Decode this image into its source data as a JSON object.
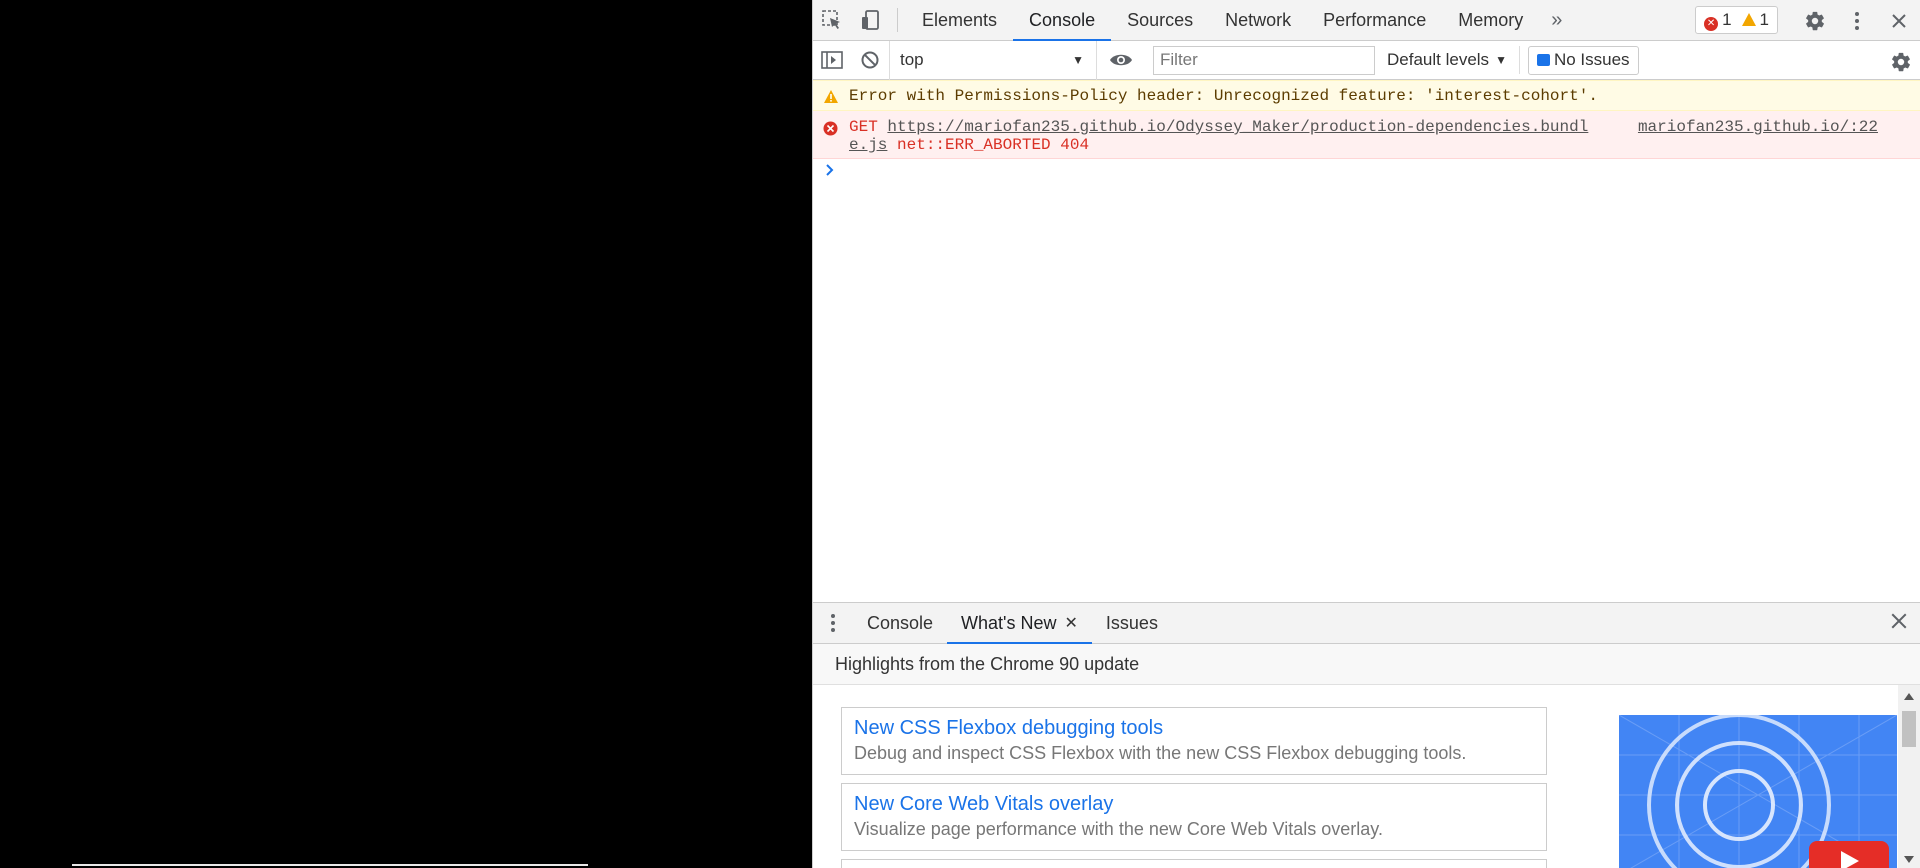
{
  "main_tabs": [
    {
      "label": "Elements",
      "active": false
    },
    {
      "label": "Console",
      "active": true
    },
    {
      "label": "Sources",
      "active": false
    },
    {
      "label": "Network",
      "active": false
    },
    {
      "label": "Performance",
      "active": false
    },
    {
      "label": "Memory",
      "active": false
    }
  ],
  "counters": {
    "errors": "1",
    "warnings": "1"
  },
  "console_toolbar": {
    "context": "top",
    "filter_placeholder": "Filter",
    "levels": "Default levels",
    "issues": "No Issues"
  },
  "messages": {
    "warning": "Error with Permissions-Policy header: Unrecognized feature: 'interest-cohort'.",
    "error_method": "GET",
    "error_url_line1": "https://mariofan235.github.io/Odyssey_Maker/production-dependencies.bundl",
    "error_url_line2": "e.js",
    "error_status": "net::ERR_ABORTED 404",
    "error_source": "mariofan235.github.io/:22"
  },
  "drawer": {
    "tabs": [
      {
        "label": "Console"
      },
      {
        "label": "What's New"
      },
      {
        "label": "Issues"
      }
    ],
    "header": "Highlights from the Chrome 90 update",
    "features": [
      {
        "title": "New CSS Flexbox debugging tools",
        "desc": "Debug and inspect CSS Flexbox with the new CSS Flexbox debugging tools."
      },
      {
        "title": "New Core Web Vitals overlay",
        "desc": "Visualize page performance with the new Core Web Vitals overlay."
      }
    ]
  },
  "colors": {
    "accent": "#1a73e8",
    "error": "#d93025",
    "warning": "#f2a600",
    "hero": "#4285f4"
  }
}
